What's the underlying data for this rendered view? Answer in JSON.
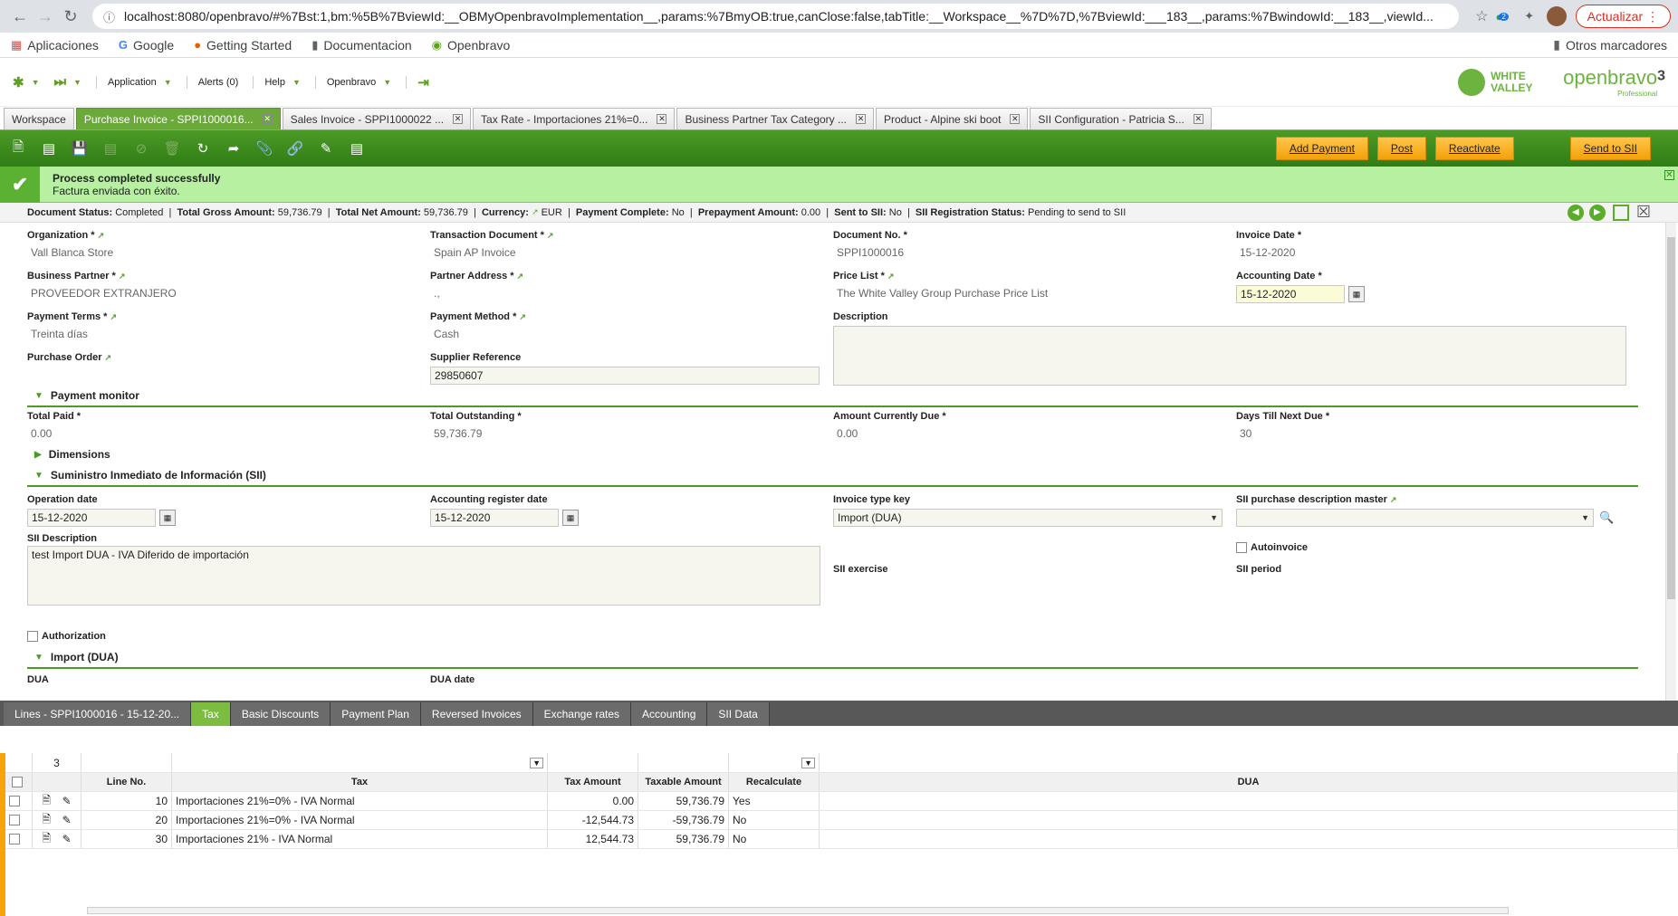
{
  "browser": {
    "url": "localhost:8080/openbravo/#%7Bst:1,bm:%5B%7BviewId:__OBMyOpenbravoImplementation__,params:%7BmyOB:true,canClose:false,tabTitle:__Workspace__%7D%7D,%7BviewId:___183__,params:%7BwindowId:__183__,viewId...",
    "update_label": "Actualizar",
    "extension_badge": "2",
    "bookmarks": [
      "Aplicaciones",
      "Google",
      "Getting Started",
      "Documentacion",
      "Openbravo"
    ],
    "other_bookmarks": "Otros marcadores"
  },
  "appnav": {
    "application": "Application",
    "alerts": "Alerts (0)",
    "help": "Help",
    "openbravo": "Openbravo",
    "logo_wv": "WHITE VALLEY",
    "logo_ob": "openbravo",
    "logo_ob_version": "3",
    "logo_ob_sub": "Professional"
  },
  "tabs": [
    {
      "label": "Workspace",
      "closable": false
    },
    {
      "label": "Purchase Invoice - SPPI1000016...",
      "closable": true,
      "active": true
    },
    {
      "label": "Sales Invoice - SPPI1000022 ...",
      "closable": true
    },
    {
      "label": "Tax Rate - Importaciones 21%=0...",
      "closable": true
    },
    {
      "label": "Business Partner Tax Category ...",
      "closable": true
    },
    {
      "label": "Product - Alpine ski boot",
      "closable": true
    },
    {
      "label": "SII Configuration - Patricia S...",
      "closable": true
    }
  ],
  "toolbar": {
    "add_payment": "Add Payment",
    "post": "Post",
    "reactivate": "Reactivate",
    "send_to_sii": "Send to SII"
  },
  "message": {
    "title": "Process completed successfully",
    "text": "Factura enviada con éxito."
  },
  "status": {
    "doc_status_label": "Document Status:",
    "doc_status": "Completed",
    "gross_label": "Total Gross Amount:",
    "gross": "59,736.79",
    "net_label": "Total Net Amount:",
    "net": "59,736.79",
    "currency_label": "Currency:",
    "currency": "EUR",
    "pay_complete_label": "Payment Complete:",
    "pay_complete": "No",
    "prepay_label": "Prepayment Amount:",
    "prepay": "0.00",
    "sent_label": "Sent to SII:",
    "sent": "No",
    "reg_label": "SII Registration Status:",
    "reg": "Pending to send to SII"
  },
  "form": {
    "organization": {
      "label": "Organization *",
      "value": "Vall Blanca Store"
    },
    "transaction_document": {
      "label": "Transaction Document *",
      "value": "Spain AP Invoice"
    },
    "document_no": {
      "label": "Document No. *",
      "value": "SPPI1000016"
    },
    "invoice_date": {
      "label": "Invoice Date *",
      "value": "15-12-2020"
    },
    "business_partner": {
      "label": "Business Partner *",
      "value": "PROVEEDOR EXTRANJERO"
    },
    "partner_address": {
      "label": "Partner Address *",
      "value": ".,"
    },
    "price_list": {
      "label": "Price List *",
      "value": "The White Valley Group Purchase Price List"
    },
    "accounting_date": {
      "label": "Accounting Date *",
      "value": "15-12-2020"
    },
    "payment_terms": {
      "label": "Payment Terms *",
      "value": "Treinta días"
    },
    "payment_method": {
      "label": "Payment Method *",
      "value": "Cash"
    },
    "description": {
      "label": "Description",
      "value": ""
    },
    "purchase_order": {
      "label": "Purchase Order",
      "value": ""
    },
    "supplier_reference": {
      "label": "Supplier Reference",
      "value": "29850607"
    },
    "section_payment_monitor": "Payment monitor",
    "total_paid": {
      "label": "Total Paid *",
      "value": "0.00"
    },
    "total_outstanding": {
      "label": "Total Outstanding *",
      "value": "59,736.79"
    },
    "amount_due": {
      "label": "Amount Currently Due *",
      "value": "0.00"
    },
    "days_till_due": {
      "label": "Days Till Next Due *",
      "value": "30"
    },
    "section_dimensions": "Dimensions",
    "section_sii": "Suministro Inmediato de Información (SII)",
    "operation_date": {
      "label": "Operation date",
      "value": "15-12-2020"
    },
    "acct_register_date": {
      "label": "Accounting register date",
      "value": "15-12-2020"
    },
    "invoice_type_key": {
      "label": "Invoice type key",
      "value": "Import (DUA)"
    },
    "sii_purchase_desc": {
      "label": "SII purchase description master",
      "value": ""
    },
    "sii_description": {
      "label": "SII Description",
      "value": "test Import DUA - IVA Diferido de importación"
    },
    "autoinvoice": "Autoinvoice",
    "sii_exercise": "SII exercise",
    "sii_period": "SII period",
    "authorization": "Authorization",
    "section_import": "Import (DUA)",
    "dua": "DUA",
    "dua_date": "DUA date"
  },
  "subtabs": [
    {
      "label": "Lines - SPPI1000016 - 15-12-20..."
    },
    {
      "label": "Tax",
      "active": true
    },
    {
      "label": "Basic Discounts"
    },
    {
      "label": "Payment Plan"
    },
    {
      "label": "Reversed Invoices"
    },
    {
      "label": "Exchange rates"
    },
    {
      "label": "Accounting"
    },
    {
      "label": "SII Data"
    }
  ],
  "grid": {
    "record_count": "3",
    "columns": [
      "Line No.",
      "Tax",
      "Tax Amount",
      "Taxable Amount",
      "Recalculate",
      "DUA"
    ],
    "rows": [
      {
        "line": "10",
        "tax": "Importaciones 21%=0% - IVA Normal",
        "tax_amount": "0.00",
        "taxable": "59,736.79",
        "recalc": "Yes",
        "dua": ""
      },
      {
        "line": "20",
        "tax": "Importaciones 21%=0% - IVA Normal",
        "tax_amount": "-12,544.73",
        "taxable": "-59,736.79",
        "recalc": "No",
        "dua": ""
      },
      {
        "line": "30",
        "tax": "Importaciones 21% - IVA Normal",
        "tax_amount": "12,544.73",
        "taxable": "59,736.79",
        "recalc": "No",
        "dua": ""
      }
    ]
  },
  "colors": {
    "accent_green": "#4c9a26",
    "button_orange": "#f3a108",
    "message_bg": "#b6f0a0"
  }
}
